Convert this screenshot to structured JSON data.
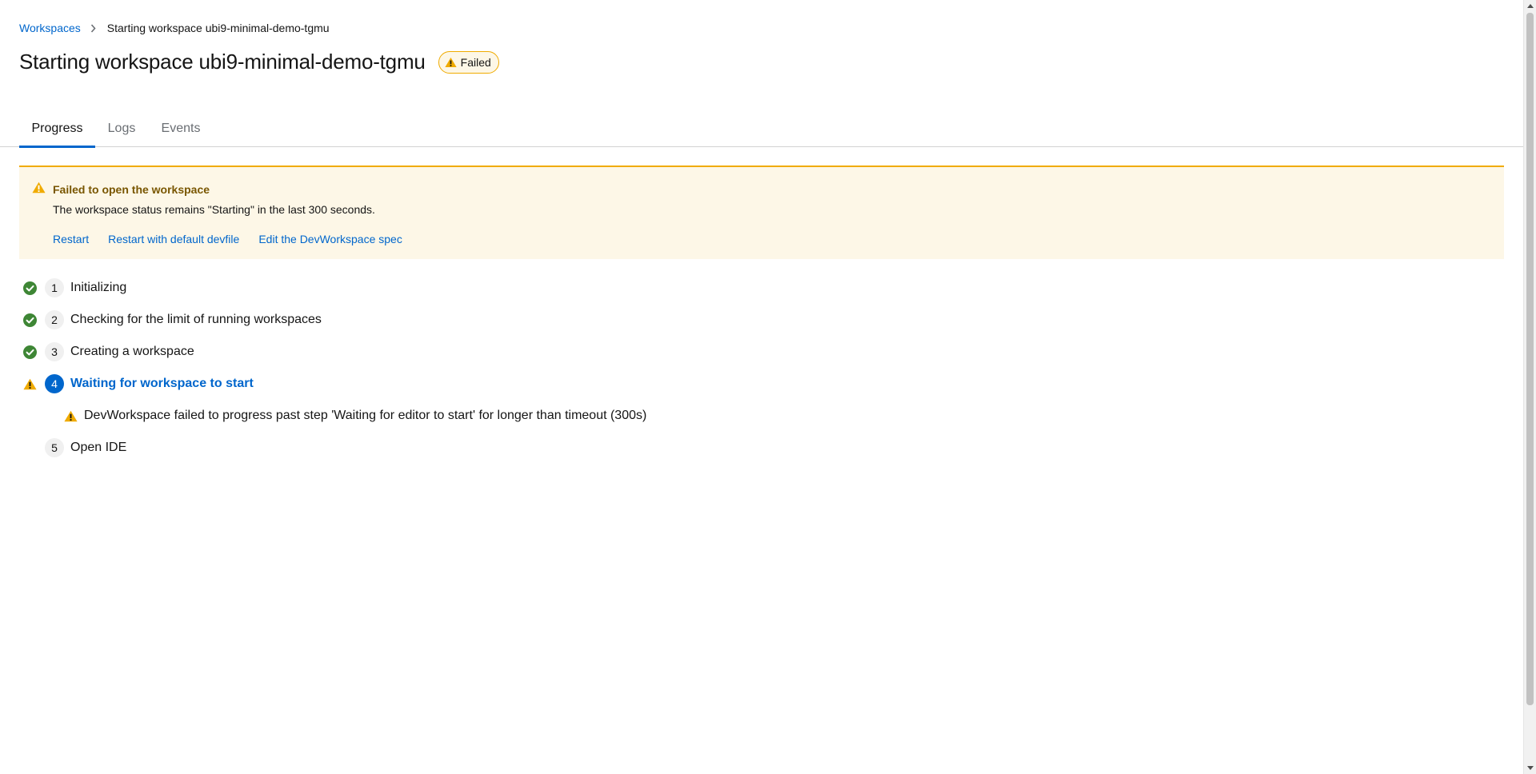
{
  "breadcrumb": {
    "parent": "Workspaces",
    "current": "Starting workspace ubi9-minimal-demo-tgmu"
  },
  "header": {
    "title": "Starting workspace ubi9-minimal-demo-tgmu",
    "status_badge": "Failed"
  },
  "tabs": [
    {
      "label": "Progress",
      "active": true
    },
    {
      "label": "Logs",
      "active": false
    },
    {
      "label": "Events",
      "active": false
    }
  ],
  "alert": {
    "title": "Failed to open the workspace",
    "description": "The workspace status remains \"Starting\" in the last 300 seconds.",
    "actions": [
      "Restart",
      "Restart with default devfile",
      "Edit the DevWorkspace spec"
    ]
  },
  "steps": [
    {
      "number": "1",
      "label": "Initializing",
      "status": "done"
    },
    {
      "number": "2",
      "label": "Checking for the limit of running workspaces",
      "status": "done"
    },
    {
      "number": "3",
      "label": "Creating a workspace",
      "status": "done"
    },
    {
      "number": "4",
      "label": "Waiting for workspace to start",
      "status": "warning",
      "message": "DevWorkspace failed to progress past step 'Waiting for editor to start' for longer than timeout (300s)"
    },
    {
      "number": "5",
      "label": "Open IDE",
      "status": "pending"
    }
  ],
  "colors": {
    "link": "#0066cc",
    "success": "#3e8635",
    "warning": "#f0ab00",
    "alert_bg": "#fdf7e7",
    "alert_title": "#795600"
  },
  "icons": {
    "breadcrumb_separator": "chevron-right-icon",
    "badge": "warning-triangle-icon",
    "step_done": "check-circle-icon",
    "step_warning": "warning-triangle-icon"
  }
}
